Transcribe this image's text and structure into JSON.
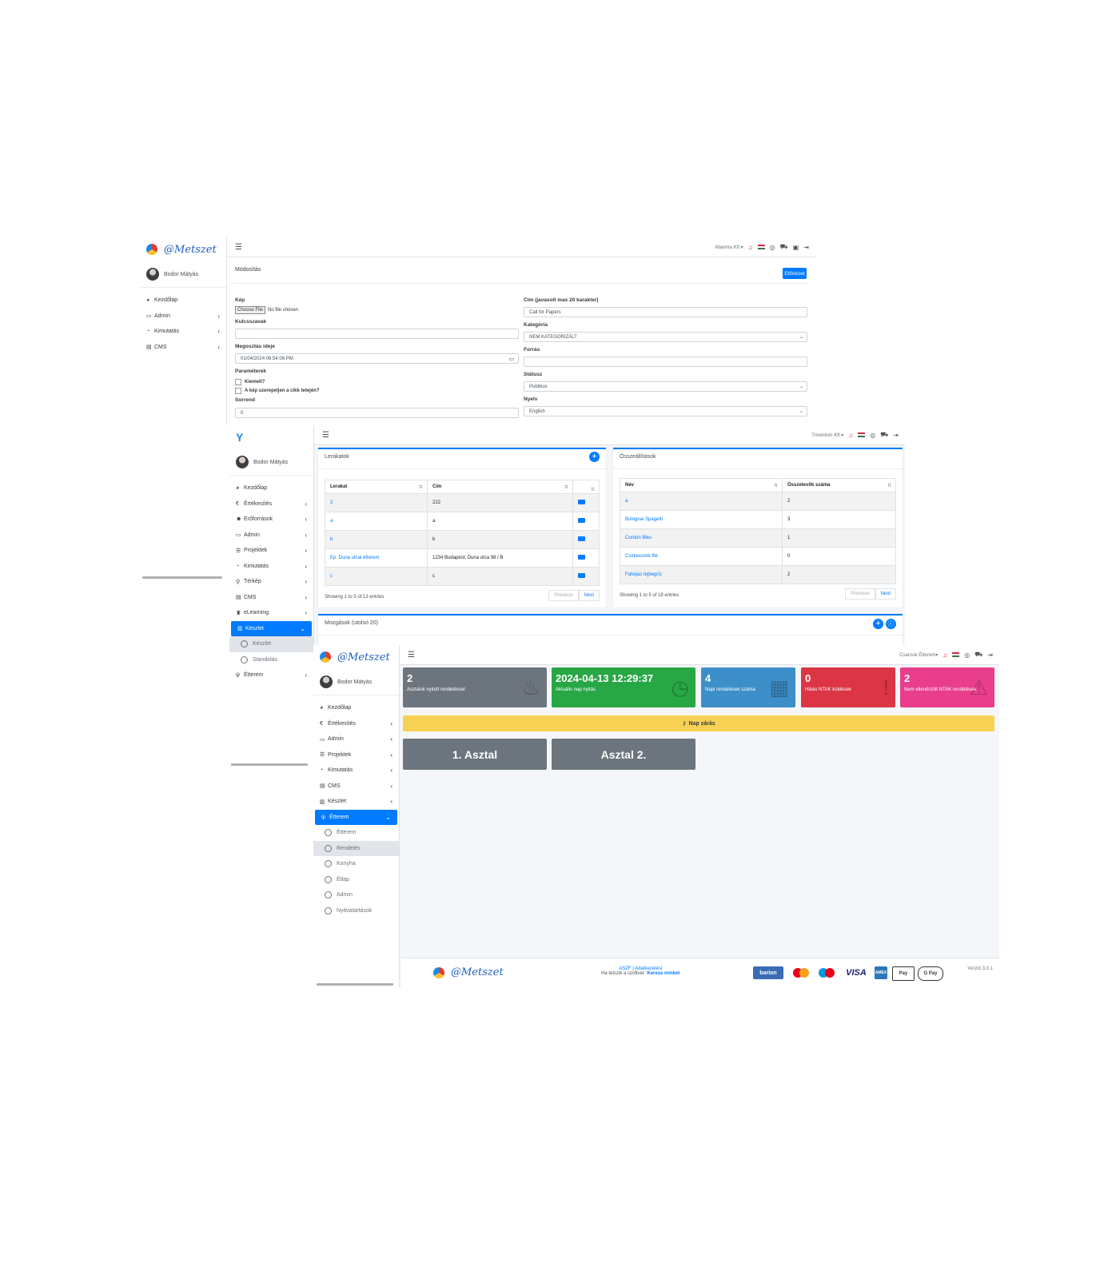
{
  "brand": {
    "logo_text": "@Metszet"
  },
  "user": {
    "name": "Bodor Mátyás"
  },
  "win1": {
    "company": "Altamira Kft.▾",
    "nav": [
      {
        "icon": "dashboard-icon",
        "label": "Kezdőlap"
      },
      {
        "icon": "monitor-icon",
        "label": "Admin"
      },
      {
        "icon": "pie-chart-icon",
        "label": "Kimutatás"
      },
      {
        "icon": "cms-icon",
        "label": "CMS"
      }
    ],
    "page_title": "Módosítás",
    "preview_button": "Előnézet",
    "image_label": "Kép",
    "choose_file": "Choose File",
    "no_file": "No file chosen",
    "keywords_label": "Kulcsszavak",
    "share_time_label": "Megosztás ideje",
    "share_time_value": "01/04/2024 06:54:06 PM",
    "params_label": "Paraméterek",
    "featured_label": "Kiemelt?",
    "image_on_top_label": "A kép szerepeljen a cikk tetején?",
    "order_label": "Sorrend",
    "order_value": "0",
    "title_label": "Cím (javasolt max 20 karakter)",
    "title_value": "Call for Papers",
    "category_label": "Kategória",
    "category_value": "NEM KATEGORIZÁLT",
    "source_label": "Forrás",
    "status_label": "Státusz",
    "status_value": "Publikus",
    "language_label": "Nyelv",
    "language_value": "English"
  },
  "win2": {
    "company": "Triventum Kft.▾",
    "nav": [
      {
        "label": "Kezdőlap"
      },
      {
        "label": "Értékesítés"
      },
      {
        "label": "Erőforrások"
      },
      {
        "label": "Admin"
      },
      {
        "label": "Projektek"
      },
      {
        "label": "Kimutatás"
      },
      {
        "label": "Térkép"
      },
      {
        "label": "CMS"
      },
      {
        "label": "eLearning"
      },
      {
        "label": "Készlet"
      },
      {
        "label": "Készlet"
      },
      {
        "label": "Standolás"
      },
      {
        "label": "Étterem"
      }
    ],
    "warehouses": {
      "title": "Lerakatok",
      "headers": [
        "Lerakat",
        "Cím",
        ""
      ],
      "rows": [
        [
          "2",
          "222"
        ],
        [
          "a",
          "a"
        ],
        [
          "b",
          "b"
        ],
        [
          "Ep. Duna utcai étterem",
          "1234 Budapest, Duna utca 98 / B"
        ],
        [
          "c",
          "c"
        ]
      ],
      "info": "Showing 1 to 5 of 13 entries",
      "prev": "Previous",
      "next": "Next"
    },
    "assemblies": {
      "title": "Összeállítások",
      "headers": [
        "Név",
        "Összetevők száma"
      ],
      "rows": [
        [
          "a",
          "2"
        ],
        [
          "Bolognai Spagetti",
          "3"
        ],
        [
          "Cordon Bleu",
          "1"
        ],
        [
          "Csirkecomb filé",
          "0"
        ],
        [
          "Fahéjas tejbegríz",
          "2"
        ]
      ],
      "info": "Showing 1 to 5 of 18 entries",
      "prev": "Previous",
      "next": "Next"
    },
    "movements_title": "Mozgások (utolsó 20)"
  },
  "win3": {
    "company": "Csarnok Étterem▾",
    "nav": [
      {
        "label": "Kezdőlap"
      },
      {
        "label": "Értékesítés"
      },
      {
        "label": "Admin"
      },
      {
        "label": "Projektek"
      },
      {
        "label": "Kimutatás"
      },
      {
        "label": "CMS"
      },
      {
        "label": "Készlet"
      },
      {
        "label": "Étterem"
      },
      {
        "label": "Étterem"
      },
      {
        "label": "Rendelés"
      },
      {
        "label": "Konyha"
      },
      {
        "label": "Étlap"
      },
      {
        "label": "Admin"
      },
      {
        "label": "Nyitvatartások"
      }
    ],
    "stats": [
      {
        "value": "2",
        "label": "Asztalok nyitott rendeléssel",
        "color": "#6c757d"
      },
      {
        "value": "2024-04-13 12:29:37",
        "label": "Aktuális nap nyitás",
        "color": "#28a745"
      },
      {
        "value": "4",
        "label": "Napi rendelések száma",
        "color": "#3d8fc9"
      },
      {
        "value": "0",
        "label": "Hibás NTAK küldések",
        "color": "#dc3545"
      },
      {
        "value": "2",
        "label": "Nem ellenőrzött NTAK rendelések",
        "color": "#e83e8c"
      }
    ],
    "close_day": "Nap zárás",
    "tables": [
      "1. Asztal",
      "Asztal 2."
    ],
    "footer_links": "ASZF | Adatkezelési",
    "footer_like": "Ha tetszik a szoftver: ",
    "footer_like_link": "Keress minket",
    "version": "Verzió 3.0.1",
    "payments": [
      "barion",
      "mastercard",
      "maestro",
      "VISA",
      "AMEX",
      "Pay",
      "G Pay"
    ]
  }
}
